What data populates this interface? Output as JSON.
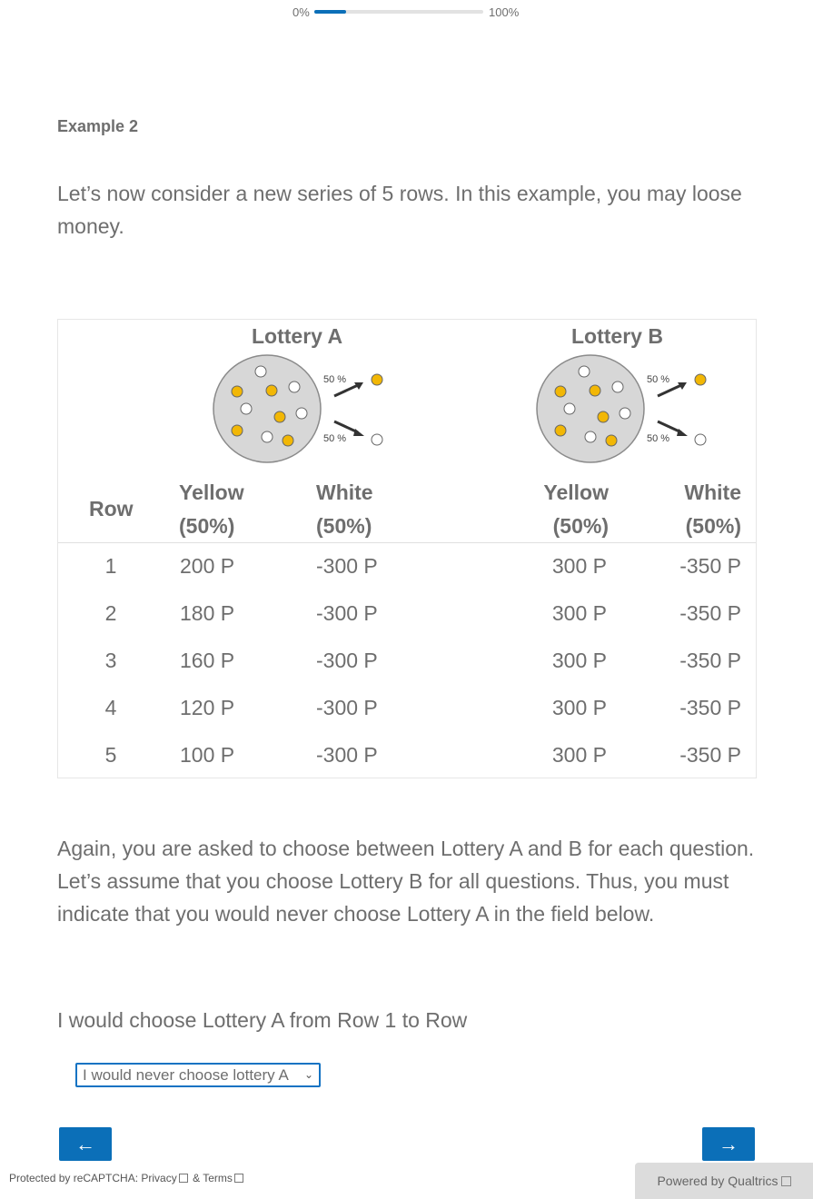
{
  "progress": {
    "start_label": "0%",
    "end_label": "100%",
    "value_percent": 19
  },
  "example_title": "Example 2",
  "intro_text": "Let’s now consider a new series of 5 rows. In this example, you may loose money.",
  "table": {
    "lottery_a_title": "Lottery A",
    "lottery_b_title": "Lottery B",
    "lottery_image": {
      "top_prob": "50 %",
      "bottom_prob": "50 %"
    },
    "headers": {
      "row": "Row",
      "yellow_a": [
        "Yellow",
        "(50%)"
      ],
      "white_a": [
        "White",
        "(50%)"
      ],
      "yellow_b": [
        "Yellow",
        "(50%)"
      ],
      "white_b": [
        "White",
        "(50%)"
      ]
    },
    "rows": [
      {
        "row": "1",
        "yellow_a": "200 P",
        "white_a": "-300 P",
        "yellow_b": "300 P",
        "white_b": "-350 P"
      },
      {
        "row": "2",
        "yellow_a": "180 P",
        "white_a": "-300 P",
        "yellow_b": "300 P",
        "white_b": "-350 P"
      },
      {
        "row": "3",
        "yellow_a": "160 P",
        "white_a": "-300 P",
        "yellow_b": "300 P",
        "white_b": "-350 P"
      },
      {
        "row": "4",
        "yellow_a": "120 P",
        "white_a": "-300 P",
        "yellow_b": "300 P",
        "white_b": "-350 P"
      },
      {
        "row": "5",
        "yellow_a": "100 P",
        "white_a": "-300 P",
        "yellow_b": "300 P",
        "white_b": "-350 P"
      }
    ]
  },
  "again_text": "Again, you are asked to choose between Lottery A and B for each question. Let’s assume that you choose Lottery B for all questions. Thus, you must indicate that you would never choose Lottery A in the field below.",
  "choose_label": "I would choose Lottery A from Row 1 to Row",
  "select": {
    "value": "I would never choose lottery A"
  },
  "nav": {
    "back": "←",
    "next": "→"
  },
  "footer": {
    "recaptcha_prefix": "Protected by reCAPTCHA: ",
    "privacy": "Privacy",
    "amp": " & ",
    "terms": "Terms",
    "powered": "Powered by Qualtrics"
  },
  "colors": {
    "accent": "#0b6fb8",
    "yellow_ball": "#f2b705",
    "text": "#6e6e6e"
  }
}
